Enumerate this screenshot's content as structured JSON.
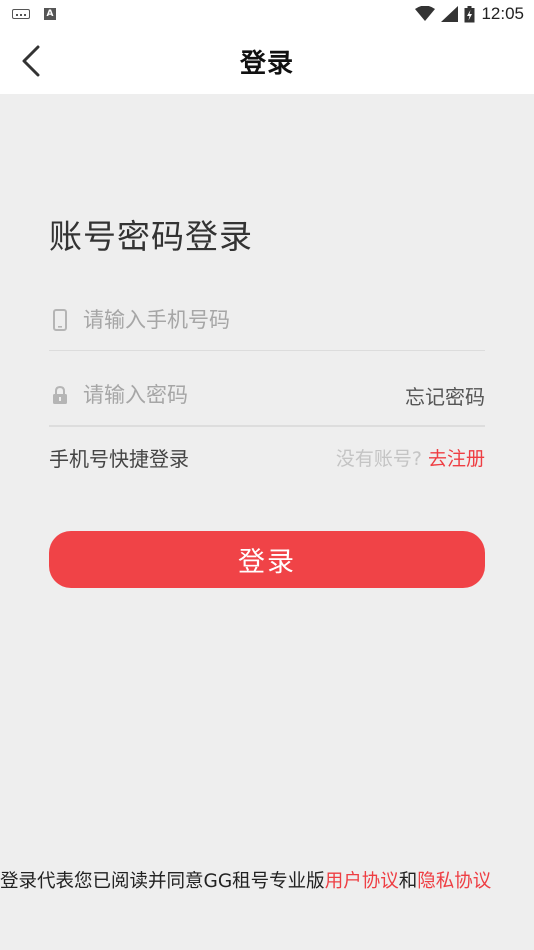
{
  "status_bar": {
    "time": "12:05",
    "icons": [
      "keyboard-icon",
      "a-icon",
      "wifi-icon",
      "signal-icon",
      "battery-icon"
    ]
  },
  "header": {
    "title": "登录",
    "back_icon": "back-arrow-icon"
  },
  "form": {
    "title": "账号密码登录",
    "phone": {
      "placeholder": "请输入手机号码",
      "value": "",
      "icon": "phone-icon"
    },
    "password": {
      "placeholder": "请输入密码",
      "value": "",
      "icon": "lock-icon"
    },
    "forgot_label": "忘记密码",
    "quick_login_label": "手机号快捷登录",
    "no_account_label": "没有账号?",
    "register_label": "去注册",
    "login_button_label": "登录"
  },
  "agreement": {
    "prefix": "登录代表您已阅读并同意GG租号专业版",
    "user_agreement": "用户协议",
    "conjunction": "和",
    "privacy_policy": "隐私协议"
  },
  "colors": {
    "accent": "#f04347",
    "link": "#ee3e43",
    "background": "#eeeeee",
    "header_bg": "#ffffff"
  }
}
